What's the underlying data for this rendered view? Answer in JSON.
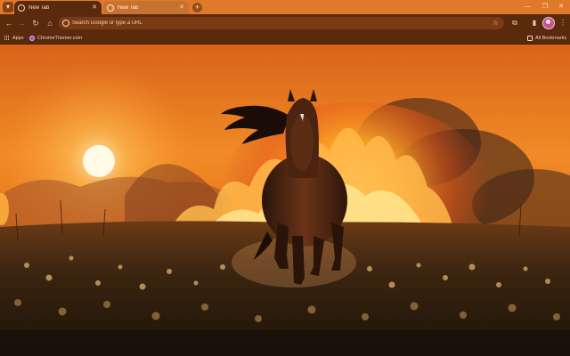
{
  "browser": {
    "tabs": [
      {
        "title": "New Tab",
        "active": true
      },
      {
        "title": "New Tab",
        "active": false
      }
    ],
    "omnibox_placeholder": "Search Google or type a URL",
    "bookmarks": [
      {
        "label": "Apps",
        "icon": "apps-grid-icon"
      },
      {
        "label": "ChromeThemer.com",
        "icon": "chromethemer-icon"
      }
    ],
    "all_bookmarks_label": "All Bookmarks"
  },
  "theme": {
    "tab_strip_color": "#e07a2a",
    "toolbar_color": "#5a2a0f",
    "inactive_tab_color": "#c8722f",
    "background_image": "horse galloping through a meadow at sunset with a wildfire behind"
  }
}
